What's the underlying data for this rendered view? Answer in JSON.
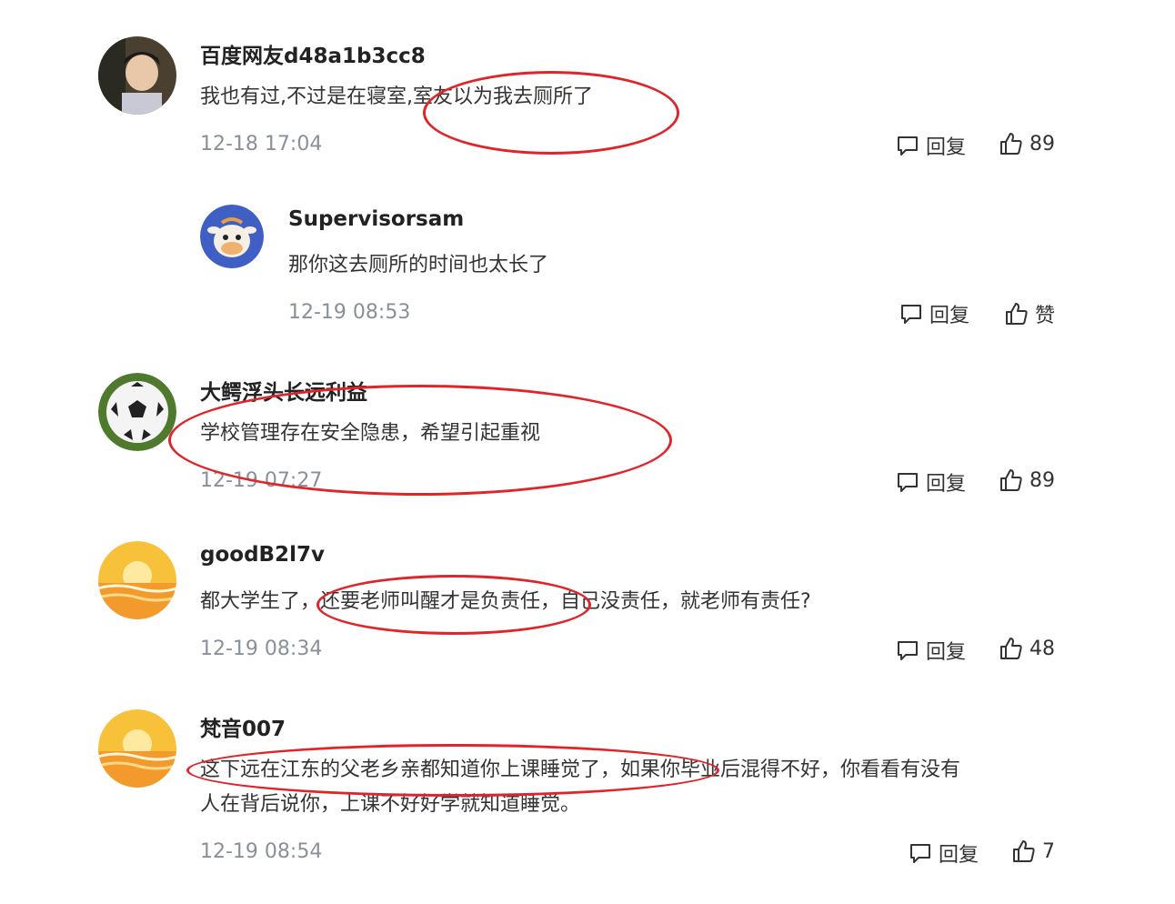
{
  "accent_color": "#e0242a",
  "comments": [
    {
      "username": "百度网友d48a1b3cc8",
      "text": "我也有过,不过是在寝室,室友以为我去厕所了",
      "time": "12-18 17:04",
      "reply_label": "回复",
      "likes": "89",
      "avatar_icon": "photo-avatar-icon"
    },
    {
      "username": "Supervisorsam",
      "text": "那你这去厕所的时间也太长了",
      "time": "12-19 08:53",
      "reply_label": "回复",
      "likes": "赞",
      "avatar_icon": "cow-cartoon-avatar-icon"
    },
    {
      "username": "大鳄浮头长远利益",
      "text": "学校管理存在安全隐患，希望引起重视",
      "time": "12-19 07:27",
      "reply_label": "回复",
      "likes": "89",
      "avatar_icon": "soccer-ball-avatar-icon"
    },
    {
      "username": "goodB2l7v",
      "text": "都大学生了，还要老师叫醒才是负责任，自己没责任，就老师有责任?",
      "time": "12-19 08:34",
      "reply_label": "回复",
      "likes": "48",
      "avatar_icon": "sunset-avatar-icon"
    },
    {
      "username": "梵音007",
      "text_line1": "这下远在江东的父老乡亲都知道你上课睡觉了，如果你毕业后混得不好，你看看有没有",
      "text_line2": "人在背后说你，上课不好好学就知道睡觉。",
      "time": "12-19 08:54",
      "reply_label": "回复",
      "likes": "7",
      "avatar_icon": "sunset-avatar-icon"
    }
  ]
}
